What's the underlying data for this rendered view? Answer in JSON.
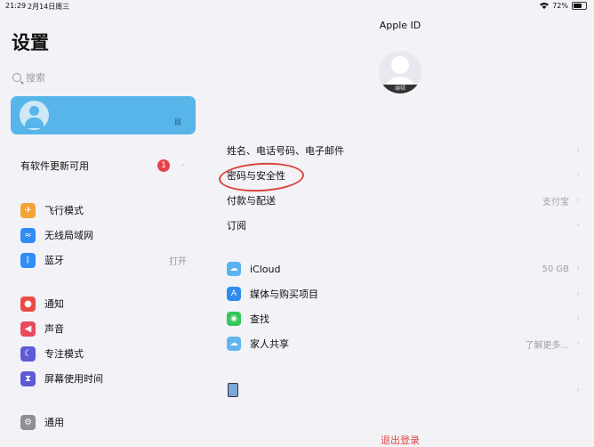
{
  "status": {
    "time": "21:29",
    "date": "2月14日周三",
    "battery": "72%",
    "battery_level": 0.72
  },
  "sidebar": {
    "title": "设置",
    "search_placeholder": "搜索",
    "profile": {
      "tail_text": "目"
    },
    "update": {
      "label": "有软件更新可用",
      "badge": "1"
    },
    "group1": [
      {
        "label": "飞行模式",
        "icon": "airplane-icon",
        "color": "#f4a235",
        "glyph": "✈",
        "value": ""
      },
      {
        "label": "无线局域网",
        "icon": "wifi-icon",
        "color": "#2f8cf2",
        "glyph": "≈",
        "value": ""
      },
      {
        "label": "蓝牙",
        "icon": "bluetooth-icon",
        "color": "#2f8cf2",
        "glyph": "ᛒ",
        "value": "打开"
      }
    ],
    "group2": [
      {
        "label": "通知",
        "icon": "bell-icon",
        "color": "#ea4a45",
        "glyph": "●"
      },
      {
        "label": "声音",
        "icon": "speaker-icon",
        "color": "#ea4a5e",
        "glyph": "◀"
      },
      {
        "label": "专注模式",
        "icon": "moon-icon",
        "color": "#5e5ad6",
        "glyph": "☾"
      },
      {
        "label": "屏幕使用时间",
        "icon": "hourglass-icon",
        "color": "#5e5ad6",
        "glyph": "⧗"
      }
    ],
    "group3": [
      {
        "label": "通用",
        "icon": "gear-icon",
        "color": "#8e8e93",
        "glyph": "⚙"
      }
    ]
  },
  "main": {
    "title": "Apple ID",
    "avatar_edit": "编辑",
    "rows1": [
      {
        "label": "姓名、电话号码、电子邮件",
        "value": ""
      },
      {
        "label": "密码与安全性",
        "value": ""
      },
      {
        "label": "付款与配送",
        "value": "支付宝"
      },
      {
        "label": "订阅",
        "value": ""
      }
    ],
    "rows2": [
      {
        "label": "iCloud",
        "value": "50 GB",
        "icon": "icloud-icon",
        "color": "#5ab2f0",
        "glyph": "☁"
      },
      {
        "label": "媒体与购买项目",
        "value": "",
        "icon": "app-store-icon",
        "color": "#2d8cf0",
        "glyph": "A"
      },
      {
        "label": "查找",
        "value": "",
        "icon": "find-my-icon",
        "color": "#34c759",
        "glyph": "◉"
      },
      {
        "label": "家人共享",
        "value": "了解更多...",
        "icon": "family-sharing-icon",
        "color": "#62b6ee",
        "glyph": "☁"
      }
    ],
    "logout": "退出登录"
  }
}
